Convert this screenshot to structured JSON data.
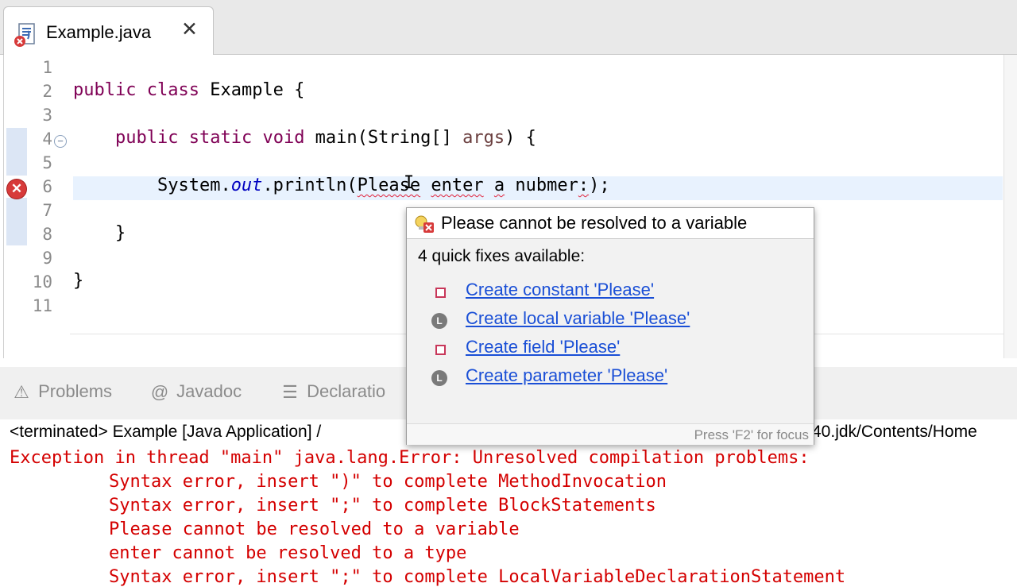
{
  "editor_tab": {
    "title": "Example.java",
    "close_glyph": "✕"
  },
  "gutter": {
    "line_numbers": [
      "1",
      "2",
      "3",
      "4",
      "5",
      "6",
      "7",
      "8",
      "9",
      "10",
      "11"
    ],
    "fold_glyph": "−",
    "error_glyph": "✕"
  },
  "code": {
    "line2": {
      "kw1": "public",
      "kw2": "class",
      "rest": " Example {"
    },
    "line4": {
      "indent": "    ",
      "kw1": "public",
      "kw2": "static",
      "kw3": "void",
      "mid": " main(String[] ",
      "param": "args",
      "end": ") {"
    },
    "line6": {
      "indent": "        ",
      "pre": "System.",
      "field": "out",
      "call": ".println(",
      "w1": "Please",
      "sp1": " ",
      "w2": "enter",
      "sp2": " ",
      "w3": "a",
      "sp3": " nubmer",
      "colon": ":",
      "end": ");"
    },
    "line8": {
      "text": "    }"
    },
    "line10": {
      "text": "}"
    }
  },
  "quick_fix": {
    "title": "Please cannot be resolved to a variable",
    "count_label": "4 quick fixes available:",
    "fixes": [
      {
        "label": "Create constant 'Please'",
        "icon": "constant-icon"
      },
      {
        "label": "Create local variable 'Please'",
        "icon": "local-variable-icon"
      },
      {
        "label": "Create field 'Please'",
        "icon": "field-icon"
      },
      {
        "label": "Create parameter 'Please'",
        "icon": "parameter-icon"
      }
    ],
    "footer": "Press 'F2' for focus",
    "local_glyph": "L"
  },
  "views": {
    "tabs": [
      {
        "label": "Problems",
        "icon": "problems-icon",
        "glyph": "⚠"
      },
      {
        "label": "Javadoc",
        "icon": "javadoc-icon",
        "glyph": "@"
      },
      {
        "label": "Declaratio",
        "icon": "declaration-icon",
        "glyph": "☰"
      }
    ]
  },
  "console": {
    "header_left": "<terminated> Example [Java Application] /",
    "header_right": "40.jdk/Contents/Home",
    "lines": [
      "Exception in thread \"main\" java.lang.Error: Unresolved compilation problems: ",
      "\tSyntax error, insert \")\" to complete MethodInvocation",
      "\tSyntax error, insert \";\" to complete BlockStatements",
      "\tPlease cannot be resolved to a variable",
      "\tenter cannot be resolved to a type",
      "\tSyntax error, insert \";\" to complete LocalVariableDeclarationStatement"
    ]
  },
  "colors": {
    "keyword": "#7f0055",
    "field": "#0000c0",
    "error_text": "#d40000",
    "link": "#1a4fd6"
  }
}
